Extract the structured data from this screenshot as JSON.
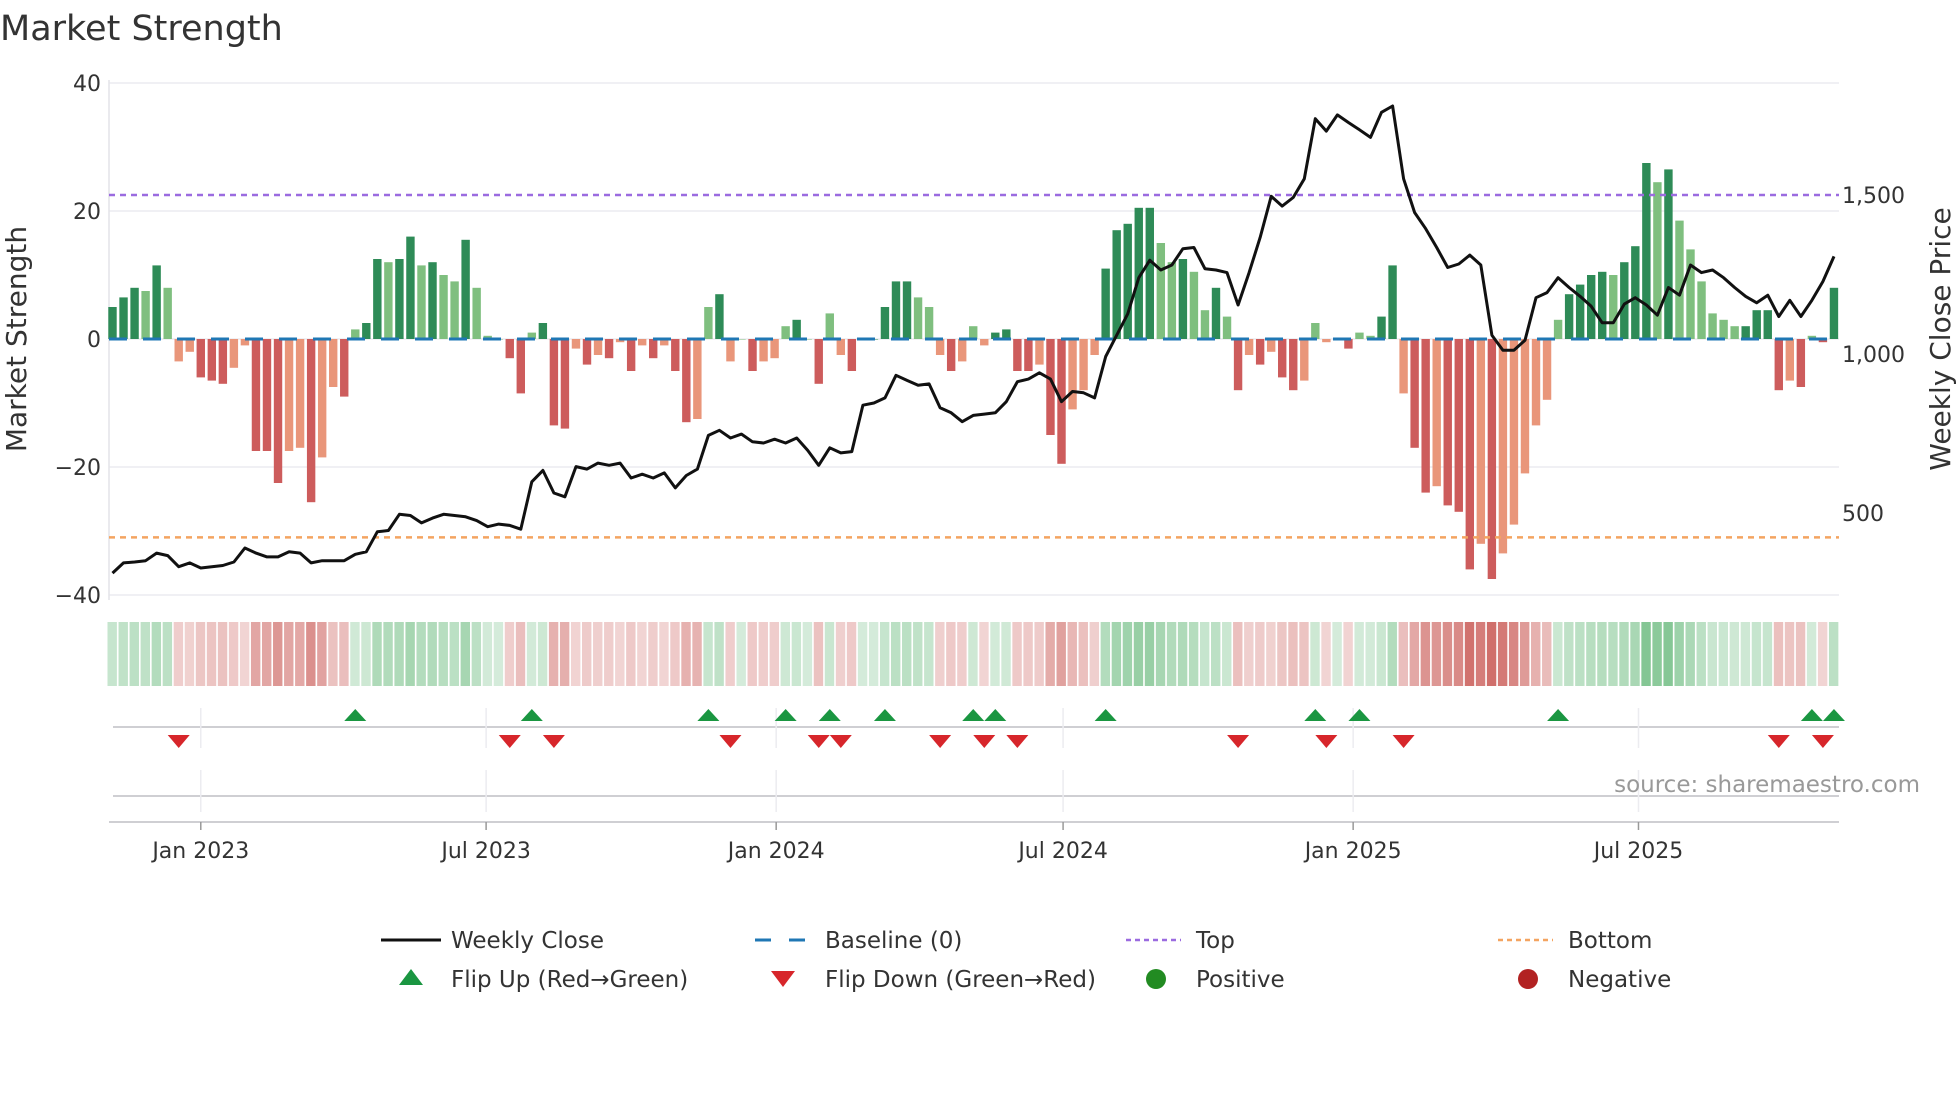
{
  "chart_data": {
    "type": "bar",
    "title": "Market Strength",
    "ylabel": "Market Strength",
    "y2label": "Weekly Close Price",
    "ylim": [
      -40,
      40
    ],
    "yticks": [
      40,
      20,
      0,
      -20,
      -40
    ],
    "ytick_labels": [
      "40",
      "20",
      "0",
      "−20",
      "−40"
    ],
    "y2ticks": [
      1500,
      1000,
      500
    ],
    "y2tick_labels": [
      "1,500",
      "1,000",
      "500"
    ],
    "y2lim_ref": {
      "value_at_strength_0": 1000,
      "units_per_strength": 19.7
    },
    "top_level": 22.5,
    "bottom_level": -31,
    "start_week": "2022-11-06",
    "xticks": [
      {
        "date": "2023-01-01",
        "label": "Jan 2023"
      },
      {
        "date": "2023-07-01",
        "label": "Jul 2023"
      },
      {
        "date": "2024-01-01",
        "label": "Jan 2024"
      },
      {
        "date": "2024-07-01",
        "label": "Jul 2024"
      },
      {
        "date": "2025-01-01",
        "label": "Jan 2025"
      },
      {
        "date": "2025-07-01",
        "label": "Jul 2025"
      }
    ],
    "strength": [
      5,
      6.5,
      8,
      7.5,
      11.5,
      8,
      -3.5,
      -2,
      -6,
      -6.5,
      -7,
      -4.5,
      -1,
      -17.5,
      -17.5,
      -22.5,
      -17.5,
      -17,
      -25.5,
      -18.5,
      -7.5,
      -9,
      1.5,
      2.5,
      12.5,
      12,
      12.5,
      16,
      11.5,
      12,
      10,
      9,
      15.5,
      8,
      0.5,
      0,
      -3,
      -8.5,
      1,
      2.5,
      -13.5,
      -14,
      -1.5,
      -4,
      -2.5,
      -3,
      -0.5,
      -5,
      -1,
      -3,
      -1,
      -5,
      -13,
      -12.5,
      5,
      7,
      -3.5,
      0,
      -5,
      -3.5,
      -3,
      2,
      3,
      0,
      -7,
      4,
      -2.5,
      -5,
      0,
      0,
      5,
      9,
      9,
      6.5,
      5,
      -2.5,
      -5,
      -3.5,
      2,
      -1,
      1,
      1.5,
      -5,
      -5,
      -4,
      -15,
      -19.5,
      -11,
      -8,
      -2.5,
      11,
      17,
      18,
      20.5,
      20.5,
      15,
      12,
      12.5,
      10.5,
      4.5,
      8,
      3.5,
      -8,
      -2.5,
      -4,
      -2,
      -6,
      -8,
      -6.5,
      2.5,
      -0.5,
      0,
      -1.5,
      1,
      0.5,
      3.5,
      11.5,
      -8.5,
      -17,
      -24,
      -23,
      -26,
      -27,
      -36,
      -32,
      -37.5,
      -33.5,
      -29,
      -21,
      -13.5,
      -9.5,
      3,
      7,
      8.5,
      10,
      10.5,
      10,
      12,
      14.5,
      27.5,
      24.5,
      26.5,
      18.5,
      14,
      9,
      4,
      3,
      2,
      2,
      4.5,
      4.5,
      -8,
      -6.5,
      -7.5,
      0.5,
      -0.5,
      8
    ],
    "weekly_close": [
      311,
      343,
      346,
      350,
      374,
      366,
      331,
      343,
      327,
      331,
      335,
      346,
      390,
      374,
      362,
      362,
      378,
      374,
      343,
      350,
      350,
      350,
      370,
      378,
      441,
      445,
      496,
      492,
      469,
      484,
      496,
      492,
      488,
      476,
      457,
      465,
      461,
      449,
      598,
      634,
      563,
      551,
      646,
      638,
      657,
      650,
      657,
      610,
      622,
      610,
      626,
      579,
      618,
      638,
      744,
      760,
      736,
      748,
      724,
      720,
      732,
      720,
      736,
      697,
      650,
      705,
      689,
      693,
      839,
      846,
      862,
      933,
      917,
      902,
      906,
      831,
      815,
      787,
      807,
      811,
      815,
      850,
      913,
      921,
      941,
      921,
      850,
      882,
      878,
      862,
      992,
      1059,
      1126,
      1240,
      1295,
      1264,
      1280,
      1331,
      1335,
      1268,
      1264,
      1256,
      1154,
      1256,
      1366,
      1496,
      1465,
      1492,
      1551,
      1740,
      1701,
      1752,
      1728,
      1705,
      1681,
      1760,
      1780,
      1551,
      1445,
      1394,
      1335,
      1272,
      1283,
      1311,
      1280,
      1059,
      1012,
      1012,
      1043,
      1177,
      1193,
      1240,
      1209,
      1181,
      1150,
      1098,
      1098,
      1157,
      1177,
      1154,
      1122,
      1209,
      1185,
      1280,
      1256,
      1264,
      1240,
      1209,
      1181,
      1161,
      1185,
      1118,
      1169,
      1118,
      1169,
      1228,
      1307
    ],
    "flip_up_weeks": [
      22,
      38,
      54,
      61,
      65,
      70,
      78,
      80,
      90,
      109,
      113,
      131,
      154,
      156
    ],
    "flip_down_weeks": [
      6,
      36,
      40,
      56,
      64,
      66,
      75,
      79,
      82,
      102,
      110,
      117,
      151,
      155
    ],
    "legend": [
      {
        "key": "close",
        "label": "Weekly Close"
      },
      {
        "key": "baseline",
        "label": "Baseline (0)"
      },
      {
        "key": "top",
        "label": "Top"
      },
      {
        "key": "bottom",
        "label": "Bottom"
      },
      {
        "key": "flipup",
        "label": "Flip Up (Red→Green)"
      },
      {
        "key": "flipdown",
        "label": "Flip Down (Green→Red)"
      },
      {
        "key": "positive",
        "label": "Positive"
      },
      {
        "key": "negative",
        "label": "Negative"
      }
    ],
    "legend_placement": "bottom",
    "source": "source: sharemaestro.com"
  },
  "colors": {
    "dark_green": "#2e8b57",
    "light_green": "#7fbf7f",
    "dark_red": "#cd5c5c",
    "light_red": "#e9967a",
    "close": "#111111",
    "baseline": "#1f77b4",
    "top": "#9b6be0",
    "bottom": "#f4a460",
    "flip_up": "#1a9641",
    "flip_down": "#d7262b",
    "positive": "#228b22",
    "negative": "#b22222"
  }
}
